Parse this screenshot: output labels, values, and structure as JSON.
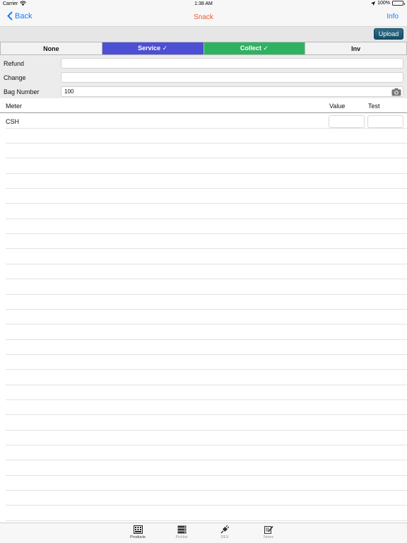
{
  "status_bar": {
    "carrier": "Carrier",
    "time": "1:38 AM",
    "battery": "100%"
  },
  "nav": {
    "back_label": "Back",
    "title": "Snack",
    "info_label": "Info"
  },
  "toolbar": {
    "upload_label": "Upload"
  },
  "segments": [
    {
      "label": "None",
      "selected": false
    },
    {
      "label": "Service ✓",
      "selected": true,
      "color": "#4d4fd4"
    },
    {
      "label": "Collect ✓",
      "selected": true,
      "color": "#2eb262"
    },
    {
      "label": "Inv",
      "selected": false
    }
  ],
  "form": {
    "refund": {
      "label": "Refund",
      "value": ""
    },
    "change": {
      "label": "Change",
      "value": ""
    },
    "bag_number": {
      "label": "Bag Number",
      "value": "100"
    }
  },
  "table": {
    "columns": {
      "meter": "Meter",
      "value": "Value",
      "test": "Test"
    },
    "rows": [
      {
        "meter": "CSH",
        "value": "",
        "test": ""
      }
    ]
  },
  "tabs": [
    {
      "label": "Products",
      "icon": "products-icon",
      "active": true
    },
    {
      "label": "Picklist",
      "icon": "picklist-icon",
      "active": false
    },
    {
      "label": "DEX",
      "icon": "dex-icon",
      "active": false
    },
    {
      "label": "Notes",
      "icon": "notes-icon",
      "active": false
    }
  ],
  "colors": {
    "accent_blue": "#1a7cf5",
    "title_orange": "#ee5a2b",
    "service": "#4d4fd4",
    "collect": "#2eb262"
  }
}
